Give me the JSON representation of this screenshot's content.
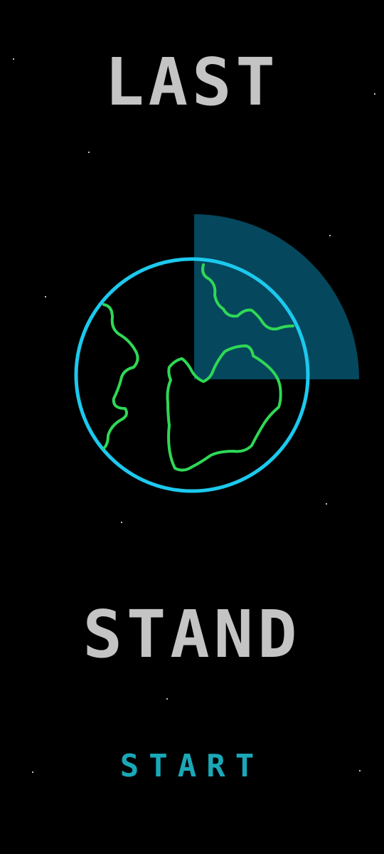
{
  "game": {
    "title_line1": "LAST",
    "title_line2": "STAND",
    "start_label": "START"
  },
  "colors": {
    "background": "#000000",
    "title": "#c4c4c4",
    "start": "#1aa8b8",
    "planet_ring": "#1cc9ee",
    "continent": "#2ed856",
    "radar_sweep": "#05475c",
    "star": "#ffffff"
  },
  "icons": {
    "planet": "planet-icon",
    "radar": "radar-sweep"
  }
}
